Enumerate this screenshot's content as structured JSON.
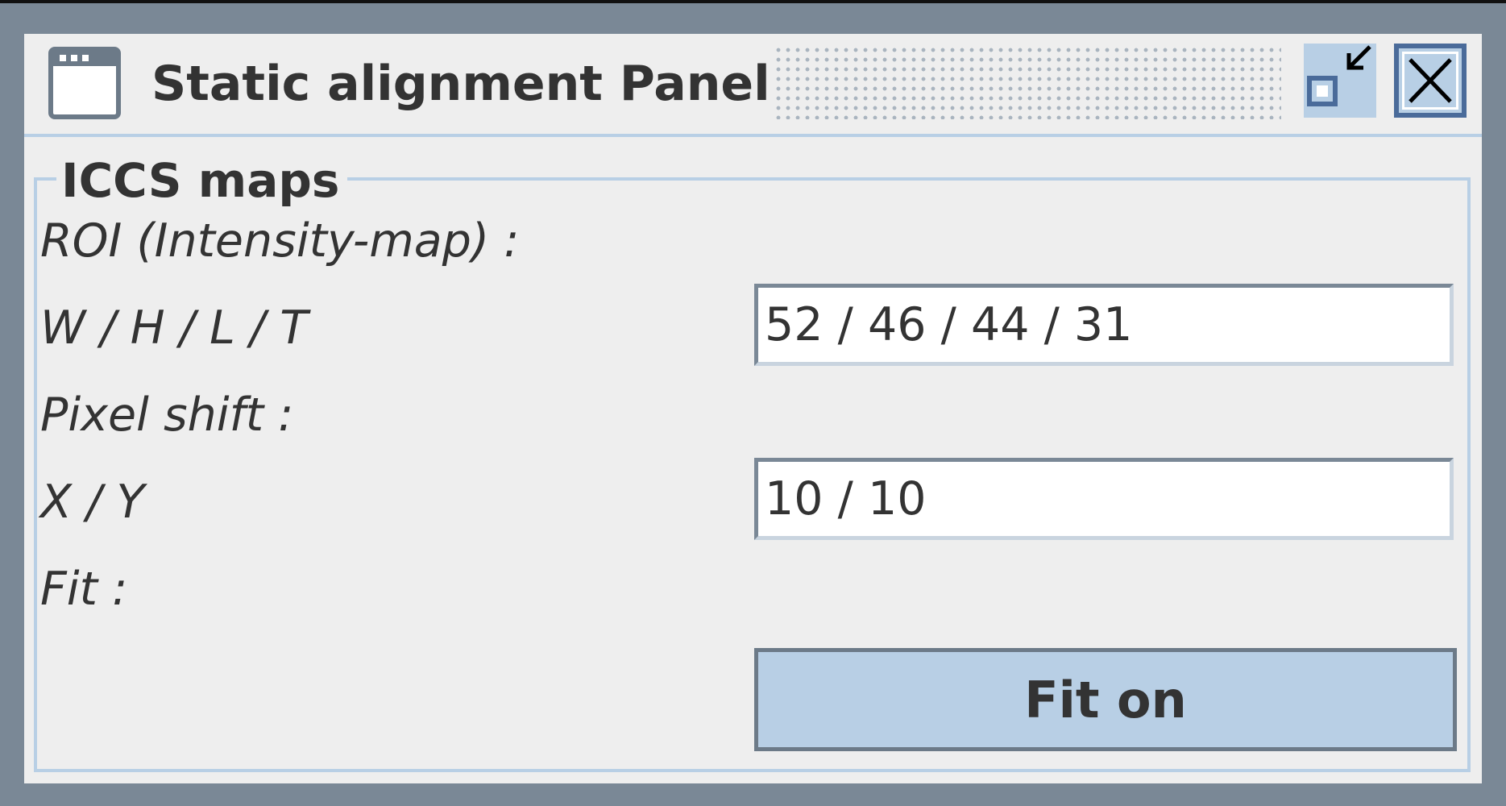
{
  "window": {
    "title": "Static alignment Panel",
    "icons": {
      "app": "window-icon",
      "restore": "restore-down-icon",
      "close": "close-icon"
    }
  },
  "group": {
    "title": "ICCS maps"
  },
  "roi": {
    "heading": "ROI (Intensity-map) :",
    "whlt_label": "W / H / L / T",
    "whlt_value": "52 / 46 / 44 / 31"
  },
  "shift": {
    "heading": "Pixel shift :",
    "xy_label": "X / Y",
    "xy_value": "10 / 10"
  },
  "fit": {
    "label": "Fit :",
    "button_label": "Fit on"
  },
  "colors": {
    "frame": "#7a8896",
    "panel_bg": "#eeeeee",
    "accent": "#b8cfe5",
    "text": "#333333"
  }
}
